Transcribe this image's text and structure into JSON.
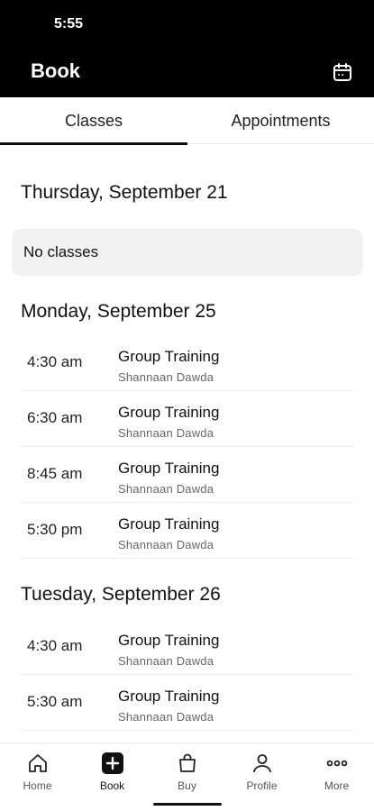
{
  "status": {
    "time": "5:55"
  },
  "header": {
    "title": "Book",
    "calendar_icon": "calendar-icon"
  },
  "tabs": [
    {
      "label": "Classes",
      "active": true
    },
    {
      "label": "Appointments",
      "active": false
    }
  ],
  "days": [
    {
      "date": "Thursday, September 21",
      "empty_text": "No classes",
      "classes": []
    },
    {
      "date": "Monday, September 25",
      "classes": [
        {
          "time": "4:30 am",
          "name": "Group Training",
          "instructor": "Shannaan Dawda"
        },
        {
          "time": "6:30 am",
          "name": "Group Training",
          "instructor": "Shannaan Dawda"
        },
        {
          "time": "8:45 am",
          "name": "Group Training",
          "instructor": "Shannaan Dawda"
        },
        {
          "time": "5:30 pm",
          "name": "Group Training",
          "instructor": "Shannaan Dawda"
        }
      ]
    },
    {
      "date": "Tuesday, September 26",
      "classes": [
        {
          "time": "4:30 am",
          "name": "Group Training",
          "instructor": "Shannaan Dawda"
        },
        {
          "time": "5:30 am",
          "name": "Group Training",
          "instructor": "Shannaan Dawda"
        }
      ]
    }
  ],
  "bottom_nav": [
    {
      "label": "Home",
      "icon": "home-icon",
      "active": false
    },
    {
      "label": "Book",
      "icon": "book-plus-icon",
      "active": true
    },
    {
      "label": "Buy",
      "icon": "shopping-bag-icon",
      "active": false
    },
    {
      "label": "Profile",
      "icon": "profile-icon",
      "active": false
    },
    {
      "label": "More",
      "icon": "more-icon",
      "active": false
    }
  ],
  "colors": {
    "header_bg": "#000000",
    "accent": "#111111",
    "card_bg": "#f2f2f2"
  }
}
